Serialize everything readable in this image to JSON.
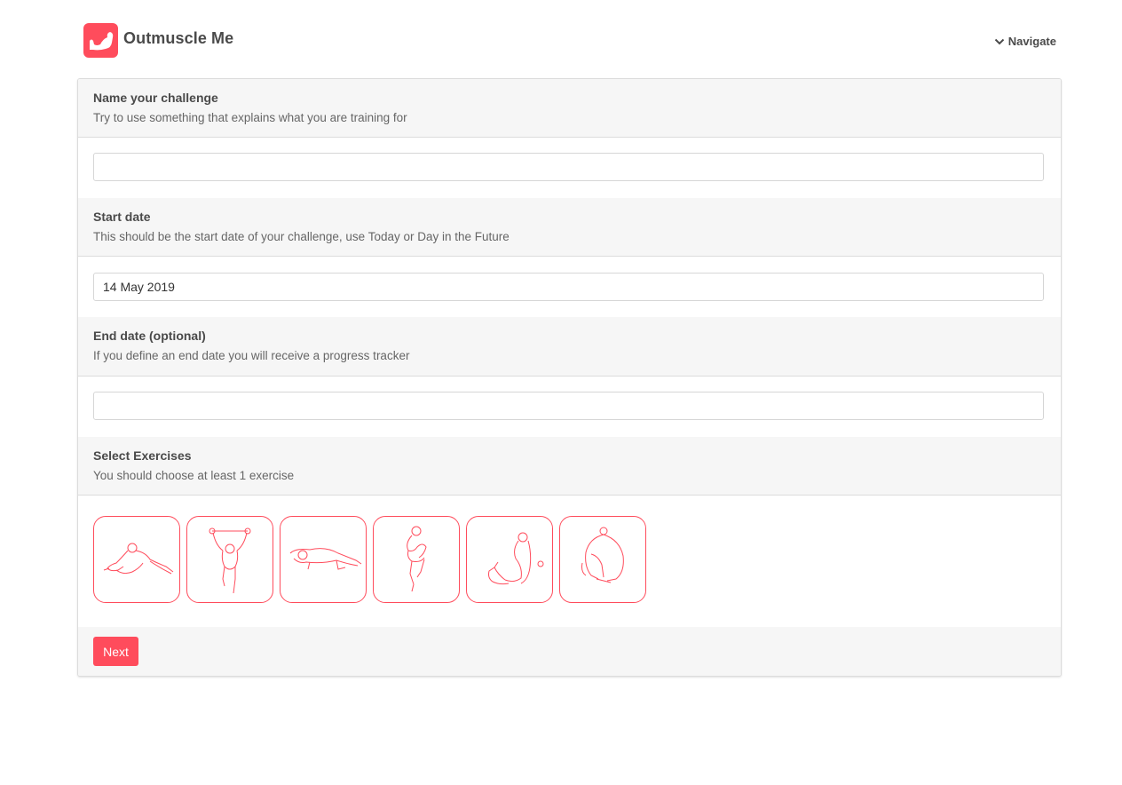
{
  "app": {
    "brand": "Outmuscle Me",
    "nav_label": "Navigate",
    "accent_color": "#ff4c5c"
  },
  "form": {
    "name": {
      "title": "Name your challenge",
      "subtitle": "Try to use something that explains what you are training for",
      "value": ""
    },
    "start_date": {
      "title": "Start date",
      "subtitle": "This should be the start date of your challenge, use Today or Day in the Future",
      "value": "14 May 2019"
    },
    "end_date": {
      "title": "End date (optional)",
      "subtitle": "If you define an end date you will receive a progress tracker",
      "value": ""
    },
    "exercises": {
      "title": "Select Exercises",
      "subtitle": "You should choose at least 1 exercise",
      "items": [
        {
          "icon": "kneeling-stretch-icon"
        },
        {
          "icon": "pull-up-icon"
        },
        {
          "icon": "push-up-icon"
        },
        {
          "icon": "squat-icon"
        },
        {
          "icon": "sit-up-icon"
        },
        {
          "icon": "crouch-stretch-icon"
        }
      ]
    },
    "next_label": "Next"
  }
}
